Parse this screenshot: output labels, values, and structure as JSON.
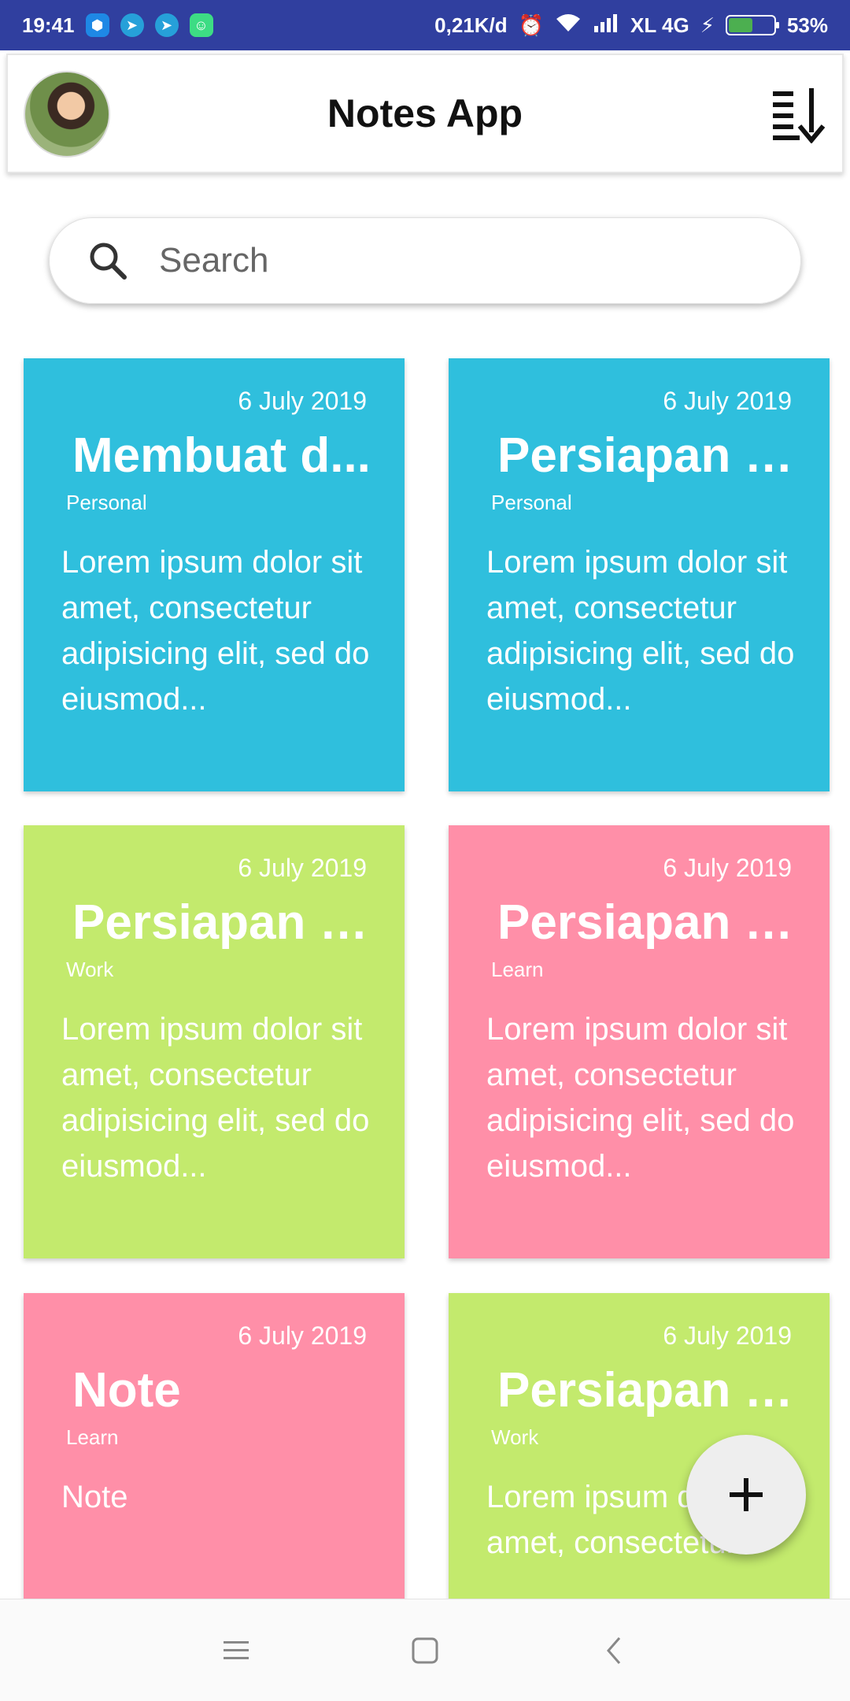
{
  "status_bar": {
    "time": "19:41",
    "speed": "0,21K/d",
    "carrier": "XL 4G",
    "battery": "53%",
    "battery_level": 0.53,
    "notification_icons": [
      "shield-app-icon",
      "telegram-icon",
      "telegram-icon",
      "android-icon"
    ]
  },
  "app_bar": {
    "title": "Notes App"
  },
  "search": {
    "placeholder": "Search"
  },
  "notes": [
    {
      "date": "6 July 2019",
      "title": "Membuat d...",
      "category": "Personal",
      "body": " Lorem ipsum dolor sit amet, consectetur adipisicing elit, sed do eiusmod...",
      "color": "#2fbfdd"
    },
    {
      "date": "6 July 2019",
      "title": "Persiapan P...",
      "category": "Personal",
      "body": " Lorem ipsum dolor sit amet, consectetur adipisicing elit, sed do eiusmod...",
      "color": "#2fbfdd"
    },
    {
      "date": "6 July 2019",
      "title": "Persiapan P...",
      "category": "Work",
      "body": " Lorem ipsum dolor sit amet, consectetur adipisicing elit, sed do eiusmod...",
      "color": "#c3ea6d"
    },
    {
      "date": "6 July 2019",
      "title": "Persiapan P...",
      "category": "Learn",
      "body": " Lorem ipsum dolor sit amet, consectetur adipisicing elit, sed do eiusmod...",
      "color": "#ff8fa8"
    },
    {
      "date": "6 July 2019",
      "title": "Note",
      "category": "Learn",
      "body": " Note",
      "color": "#ff8fa8"
    },
    {
      "date": "6 July 2019",
      "title": "Persiapan P...",
      "category": "Work",
      "body": " Lorem ipsum dolor sit amet, consectetur",
      "color": "#c3ea6d"
    }
  ],
  "fab": {
    "icon": "plus-icon"
  },
  "nav_bar": {
    "icons": [
      "menu-icon",
      "home-square-icon",
      "back-icon"
    ]
  }
}
